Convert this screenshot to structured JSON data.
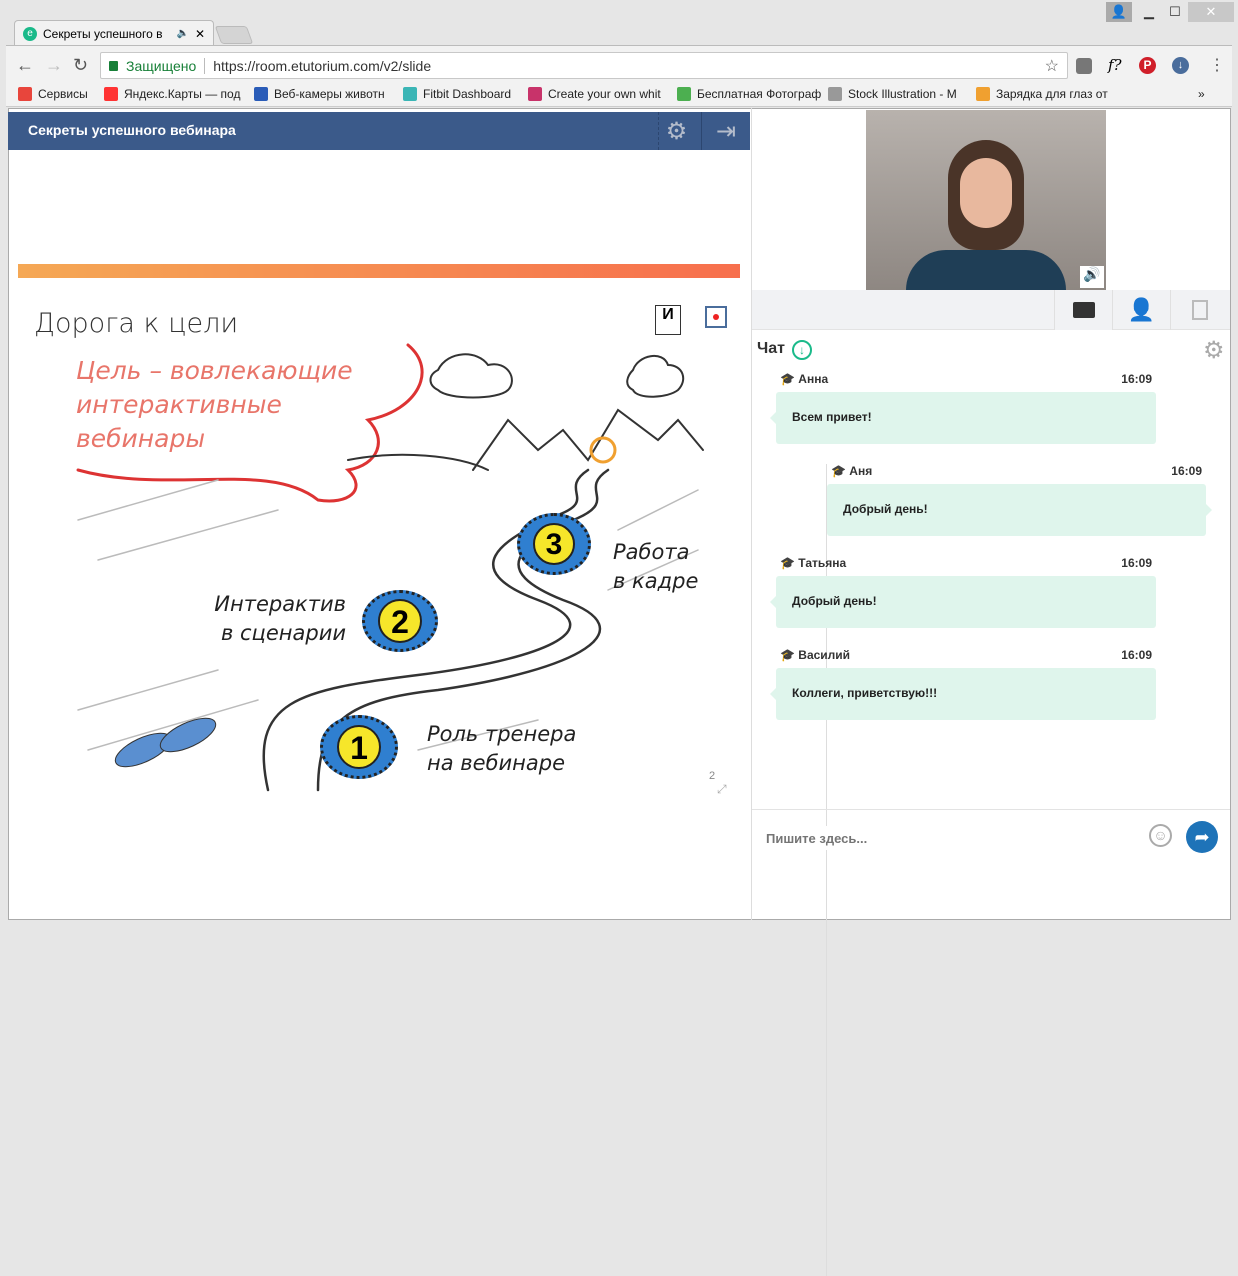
{
  "browser": {
    "tab_title": "Секреты успешного в",
    "secure_label": "Защищено",
    "url": "https://room.etutorium.com/v2/slide",
    "bookmarks": [
      {
        "label": "Сервисы",
        "color": "#e8453c"
      },
      {
        "label": "Яндекс.Карты — под",
        "color": "#f33"
      },
      {
        "label": "Веб-камеры животн",
        "color": "#2a5cb8"
      },
      {
        "label": "Fitbit Dashboard",
        "color": "#3bb6b6"
      },
      {
        "label": "Create your own whit",
        "color": "#c8336a"
      },
      {
        "label": "Бесплатная Фотограф",
        "color": "#4caf50"
      },
      {
        "label": "Stock Illustration - M",
        "color": "#999"
      },
      {
        "label": "Зарядка для глаз от",
        "color": "#f0a030"
      }
    ],
    "more_bookmarks": "»"
  },
  "webinar": {
    "title": "Секреты успешного вебинара",
    "header_color": "#3b5a8a",
    "slide": {
      "heading": "Дорога к цели",
      "goal": [
        "Цель – вовлекающие",
        "интерактивные",
        "вебинары"
      ],
      "steps": [
        {
          "num": "1",
          "label": [
            "Роль тренера",
            "на вебинаре"
          ]
        },
        {
          "num": "2",
          "label": [
            "Интерактив",
            "в сценарии"
          ]
        },
        {
          "num": "3",
          "label": [
            "Работа",
            "в кадре"
          ]
        }
      ],
      "page_number": "2"
    }
  },
  "chat": {
    "title": "Чат",
    "accent": "#1aba8a",
    "messages": [
      {
        "author": "Анна",
        "time": "16:09",
        "text": "Всем привет!",
        "side": "left"
      },
      {
        "author": "Аня",
        "time": "16:09",
        "text": "Добрый день!",
        "side": "right"
      },
      {
        "author": "Татьяна",
        "time": "16:09",
        "text": "Добрый день!",
        "side": "left"
      },
      {
        "author": "Василий",
        "time": "16:09",
        "text": "Коллеги, приветствую!!!",
        "side": "left"
      }
    ],
    "input_placeholder": "Пишите здесь...",
    "send_color": "#1e73b8"
  }
}
